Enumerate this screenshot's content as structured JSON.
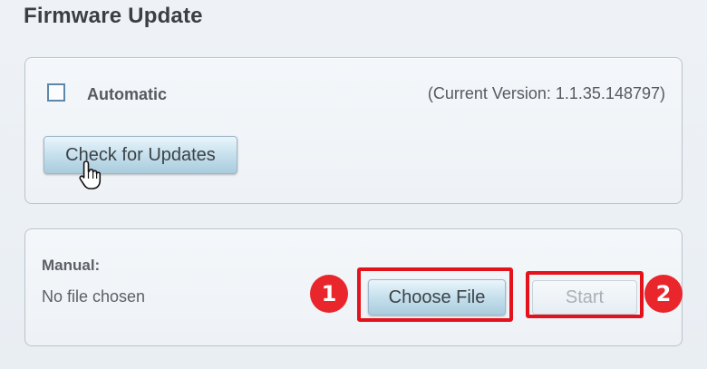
{
  "page": {
    "title": "Firmware Update"
  },
  "automatic": {
    "checkbox_checked": false,
    "label": "Automatic",
    "version_text": "(Current Version: 1.1.35.148797)",
    "check_button_label": "Check for Updates"
  },
  "manual": {
    "label": "Manual:",
    "file_status": "No file chosen",
    "choose_file_label": "Choose File",
    "start_label": "Start",
    "start_disabled": true
  },
  "annotations": {
    "step1": "1",
    "step2": "2",
    "highlight_color": "#e4121b",
    "badge_color": "#e8262c"
  },
  "icons": {
    "cursor": "hand-pointer-icon"
  }
}
